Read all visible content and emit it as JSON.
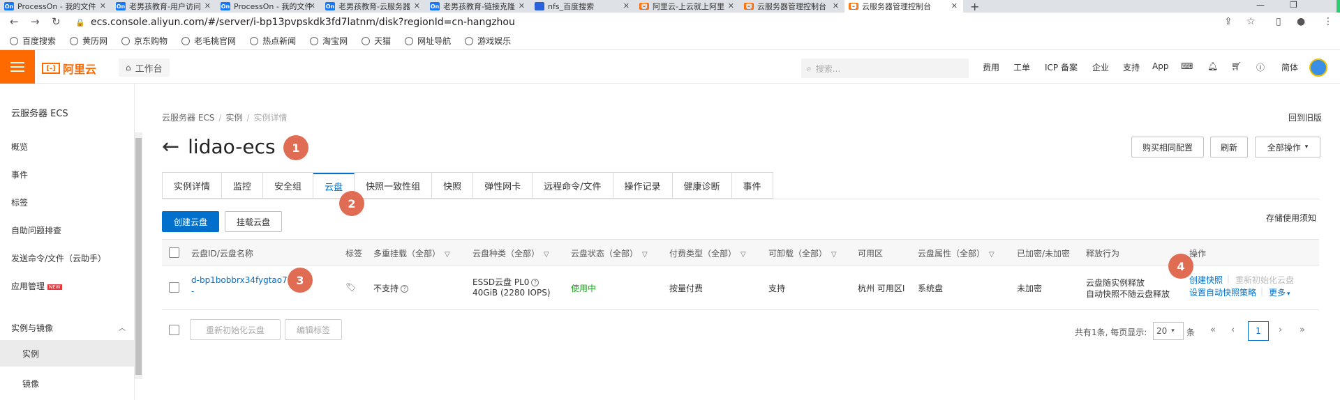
{
  "browser": {
    "tabs": [
      {
        "label": "ProcessOn - 我的文件",
        "icon": "on"
      },
      {
        "label": "老男孩教育-用户访问",
        "icon": "on"
      },
      {
        "label": "ProcessOn - 我的文件",
        "icon": "on"
      },
      {
        "label": "老男孩教育-云服务器",
        "icon": "on"
      },
      {
        "label": "老男孩教育-链接克隆",
        "icon": "on"
      },
      {
        "label": "nfs_百度搜索",
        "icon": "baidu"
      },
      {
        "label": "阿里云-上云就上阿里",
        "icon": "ali"
      },
      {
        "label": "云服务器管理控制台",
        "icon": "ali"
      },
      {
        "label": "云服务器管理控制台",
        "icon": "ali"
      }
    ],
    "fav_on": "On",
    "fav_ali": "[-]",
    "url": "ecs.console.aliyun.com/#/server/i-bp13pvpskdk3fd7latnm/disk?regionId=cn-hangzhou",
    "bookmarks": [
      "百度搜索",
      "黄历网",
      "京东购物",
      "老毛桃官网",
      "热点新闻",
      "淘宝网",
      "天猫",
      "网址导航",
      "游戏娱乐"
    ]
  },
  "topbar": {
    "logo_mark": "[-]",
    "logo_text": "阿里云",
    "workbench": "工作台",
    "search_placeholder": "搜索...",
    "nav": [
      "费用",
      "工单",
      "ICP 备案",
      "企业",
      "支持",
      "App"
    ],
    "lang": "简体"
  },
  "sidebar": {
    "title": "云服务器 ECS",
    "items": [
      "概览",
      "事件",
      "标签",
      "自助问题排查",
      "发送命令/文件（云助手）",
      "应用管理"
    ],
    "new_badge": "NEW",
    "group": "实例与镜像",
    "sub_items": [
      "实例",
      "镜像"
    ]
  },
  "main": {
    "breadcrumb": [
      "云服务器 ECS",
      "实例",
      "实例详情"
    ],
    "back_old": "回到旧版",
    "title": "lidao-ecs",
    "header_buttons": [
      "购买相同配置",
      "刷新",
      "全部操作"
    ],
    "tabs": [
      "实例详情",
      "监控",
      "安全组",
      "云盘",
      "快照一致性组",
      "快照",
      "弹性网卡",
      "远程命令/文件",
      "操作记录",
      "健康诊断",
      "事件"
    ],
    "active_tab": "云盘",
    "create_disk": "创建云盘",
    "attach_disk": "挂载云盘",
    "storage_note": "存储使用须知",
    "columns": [
      "云盘ID/云盘名称",
      "标签",
      "多重挂载（全部）",
      "云盘种类（全部）",
      "云盘状态（全部）",
      "付费类型（全部）",
      "可卸载（全部）",
      "可用区",
      "云盘属性（全部）",
      "已加密/未加密",
      "释放行为",
      "操作"
    ],
    "row": {
      "disk_id": "d-bp1bobbrx34fygtao7d5",
      "disk_name": "-",
      "multi_attach": "不支持",
      "disk_type": "ESSD云盘  PL0",
      "disk_size": "40GiB (2280 IOPS)",
      "status": "使用中",
      "billing": "按量付费",
      "detachable": "支持",
      "zone": "杭州 可用区I",
      "attribute": "系统盘",
      "encrypted": "未加密",
      "release_1": "云盘随实例释放",
      "release_2": "自动快照不随云盘释放",
      "op_snapshot": "创建快照",
      "op_reinit": "重新初始化云盘",
      "op_policy": "设置自动快照策略",
      "op_more": "更多"
    },
    "footer_buttons": [
      "重新初始化云盘",
      "编辑标签"
    ],
    "pager_text": "共有1条, 每页显示:",
    "page_size": "20",
    "page_unit": "条",
    "current_page": "1"
  },
  "markers": [
    "1",
    "2",
    "3",
    "4"
  ],
  "colors": {
    "brand": "#ff6a00",
    "primary": "#0070cc",
    "status_ok": "#1e9e1e",
    "marker": "#e06c54"
  }
}
